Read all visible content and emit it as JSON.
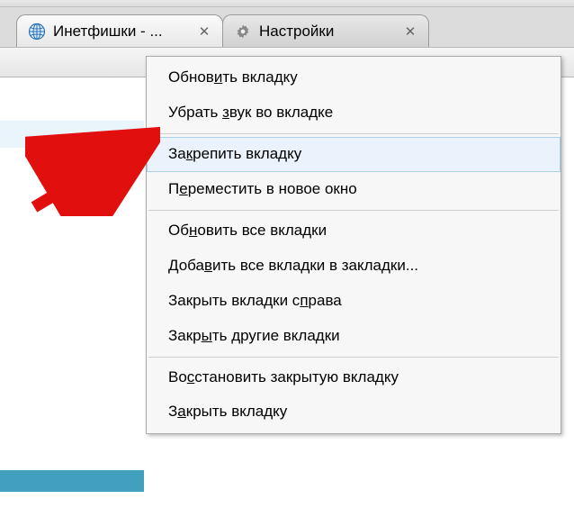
{
  "tabs": [
    {
      "title": "Инетфишки - ...",
      "icon": "globe-icon"
    },
    {
      "title": "Настройки",
      "icon": "gear-icon"
    }
  ],
  "context_menu": {
    "groups": [
      [
        {
          "before": "Обнов",
          "mnemonic": "и",
          "after": "ть вкладку"
        },
        {
          "before": "Убрать ",
          "mnemonic": "з",
          "after": "вук во вкладке"
        }
      ],
      [
        {
          "before": "За",
          "mnemonic": "к",
          "after": "репить вкладку",
          "hovered": true
        },
        {
          "before": "П",
          "mnemonic": "е",
          "after": "реместить в новое окно"
        }
      ],
      [
        {
          "before": "Об",
          "mnemonic": "н",
          "after": "овить все вкладки"
        },
        {
          "before": "Доба",
          "mnemonic": "в",
          "after": "ить все вкладки в закладки..."
        },
        {
          "before": "Закрыть вкладки с",
          "mnemonic": "п",
          "after": "рава"
        },
        {
          "before": "Закр",
          "mnemonic": "ы",
          "after": "ть другие вкладки"
        }
      ],
      [
        {
          "before": "Во",
          "mnemonic": "с",
          "after": "становить закрытую вкладку"
        },
        {
          "before": "З",
          "mnemonic": "а",
          "after": "крыть вкладку"
        }
      ]
    ]
  }
}
